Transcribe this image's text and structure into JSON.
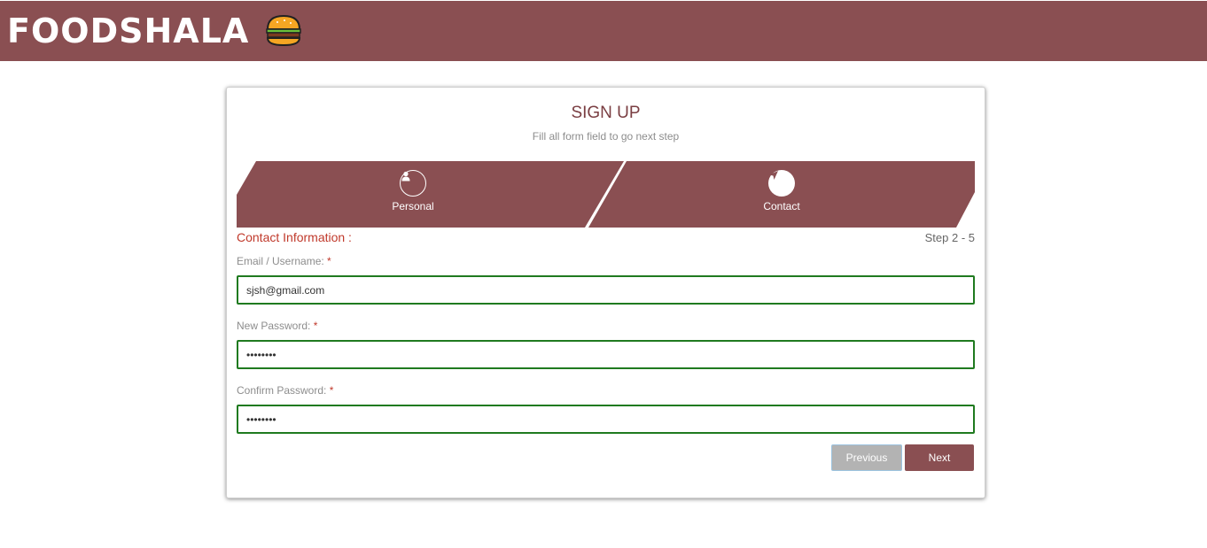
{
  "header": {
    "brand": "FOODSHALA",
    "logo_icon": "burger-icon",
    "background": "#8a4f52"
  },
  "form": {
    "title": "SIGN UP",
    "subtitle": "Fill all form field to go next step",
    "steps": [
      {
        "label": "Personal",
        "icon": "user-icon",
        "active": false
      },
      {
        "label": "Contact",
        "icon": "location-arrow-icon",
        "active": true
      }
    ],
    "section_title": "Contact Information :",
    "step_count": "Step 2 - 5",
    "fields": {
      "email": {
        "label": "Email / Username:",
        "required_mark": "*",
        "value": "sjsh@gmail.com"
      },
      "new_password": {
        "label": "New Password:",
        "required_mark": "*",
        "value": "••••••••"
      },
      "confirm_password": {
        "label": "Confirm Password:",
        "required_mark": "*",
        "value": "••••••••"
      }
    },
    "buttons": {
      "previous": "Previous",
      "next": "Next"
    }
  },
  "colors": {
    "accent": "#8a4f52",
    "valid_border": "#1f7a1f",
    "required": "#c0392b"
  }
}
